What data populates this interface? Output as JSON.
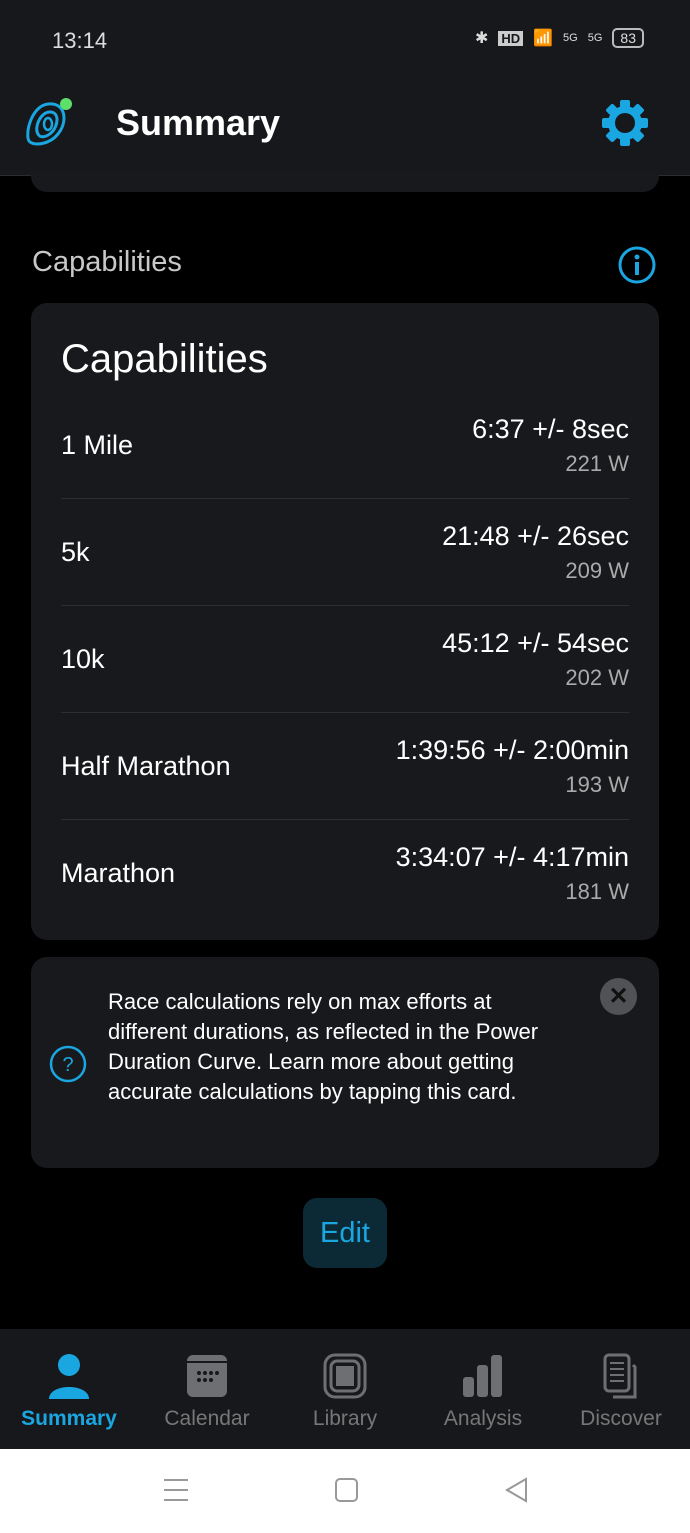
{
  "status": {
    "time": "13:14",
    "battery": "83",
    "hd": "HD",
    "net1": "5G",
    "net2": "5G"
  },
  "header": {
    "title": "Summary"
  },
  "section": {
    "title": "Capabilities"
  },
  "card": {
    "title": "Capabilities",
    "rows": [
      {
        "label": "1 Mile",
        "time": "6:37 +/- 8sec",
        "power": "221 W"
      },
      {
        "label": "5k",
        "time": "21:48 +/- 26sec",
        "power": "209 W"
      },
      {
        "label": "10k",
        "time": "45:12 +/- 54sec",
        "power": "202 W"
      },
      {
        "label": "Half Marathon",
        "time": "1:39:56 +/- 2:00min",
        "power": "193 W"
      },
      {
        "label": "Marathon",
        "time": "3:34:07 +/- 4:17min",
        "power": "181 W"
      }
    ]
  },
  "tip": {
    "text": "Race calculations rely on max efforts at different durations, as reflected in the Power Duration Curve. Learn more about getting accurate calculations by tapping this card.",
    "close": "✕"
  },
  "edit_label": "Edit",
  "nav": [
    {
      "label": "Summary",
      "icon": "person-icon",
      "active": true
    },
    {
      "label": "Calendar",
      "icon": "calendar-icon"
    },
    {
      "label": "Library",
      "icon": "library-icon"
    },
    {
      "label": "Analysis",
      "icon": "bar-chart-icon"
    },
    {
      "label": "Discover",
      "icon": "documents-icon"
    }
  ],
  "colors": {
    "accent": "#1aa6e0",
    "background": "#000000",
    "card": "#17191c",
    "header": "#16181b"
  }
}
